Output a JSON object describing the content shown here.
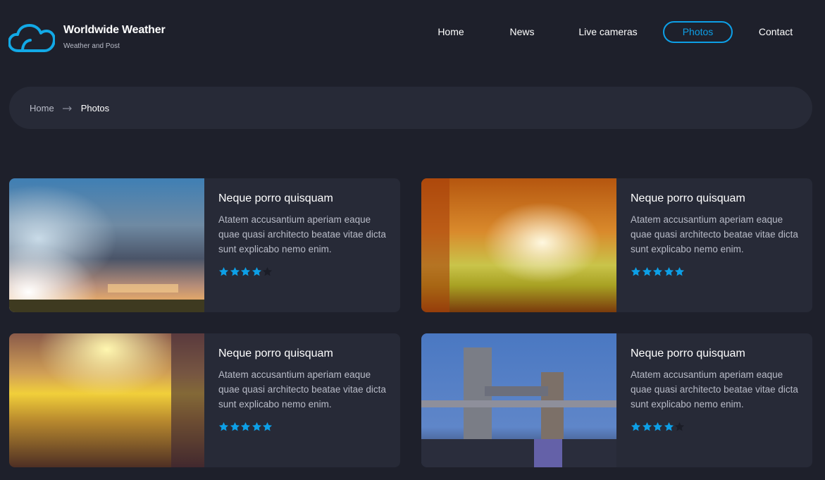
{
  "header": {
    "brand_title": "Worldwide Weather",
    "brand_subtitle": "Weather and Post",
    "logo_icon": "cloud-icon",
    "accent_color": "#0d9fe6"
  },
  "nav": {
    "items": [
      {
        "label": "Home",
        "active": false
      },
      {
        "label": "News",
        "active": false
      },
      {
        "label": "Live cameras",
        "active": false
      },
      {
        "label": "Photos",
        "active": true
      },
      {
        "label": "Contact",
        "active": false
      }
    ]
  },
  "breadcrumb": {
    "home": "Home",
    "separator_icon": "arrow-right-icon",
    "current": "Photos"
  },
  "cards": [
    {
      "title": "Neque porro quisquam",
      "text": "Atatem accusantium aperiam eaque quae quasi architecto beatae vitae dicta sunt explicabo nemo enim.",
      "rating": 4,
      "max_rating": 5,
      "image": "stormy-sky-sunset-photo"
    },
    {
      "title": "Neque porro quisquam",
      "text": "Atatem accusantium aperiam eaque quae quasi architecto beatae vitae dicta sunt explicabo nemo enim.",
      "rating": 5,
      "max_rating": 5,
      "image": "autumn-sunrise-photo"
    },
    {
      "title": "Neque porro quisquam",
      "text": "Atatem accusantium aperiam eaque quae quasi architecto beatae vitae dicta sunt explicabo nemo enim.",
      "rating": 5,
      "max_rating": 5,
      "image": "golden-field-sun-photo"
    },
    {
      "title": "Neque porro quisquam",
      "text": "Atatem accusantium aperiam eaque quae quasi architecto beatae vitae dicta sunt explicabo nemo enim.",
      "rating": 4,
      "max_rating": 5,
      "image": "tower-bridge-photo"
    }
  ],
  "colors": {
    "background": "#1e202b",
    "panel": "#272a37",
    "star_filled": "#0d9fe6",
    "star_empty": "#1b1d27"
  }
}
